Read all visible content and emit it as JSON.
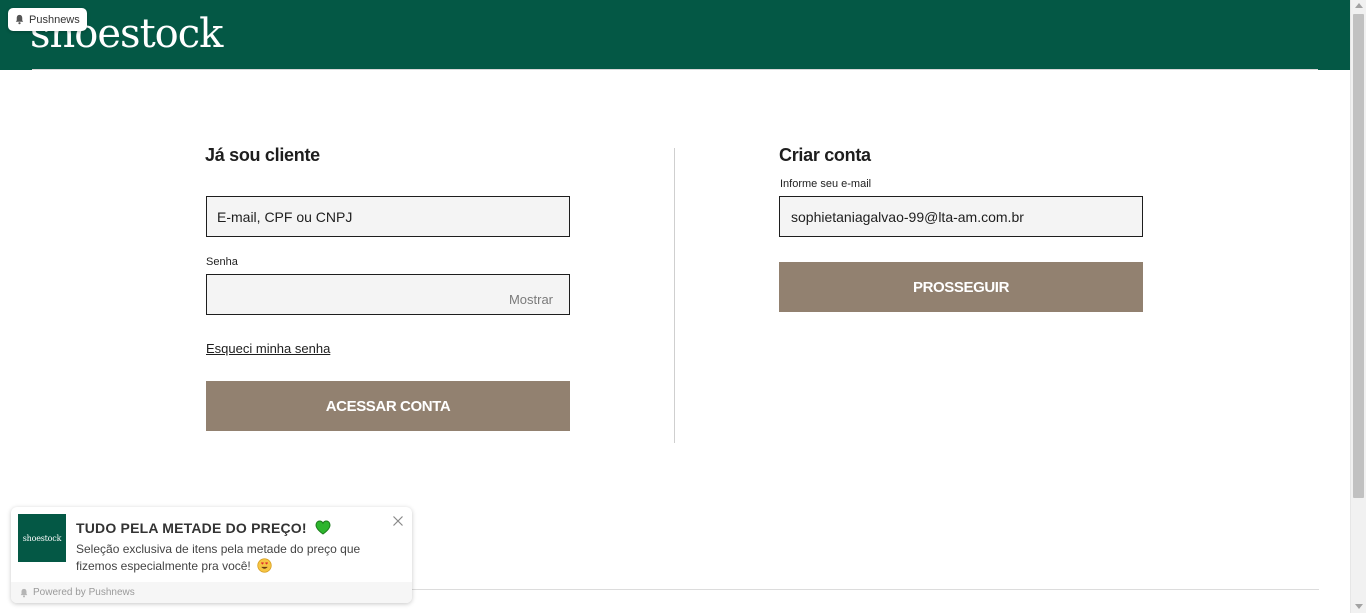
{
  "header": {
    "logo": "shoestock"
  },
  "pushnews_badge": {
    "label": "Pushnews",
    "icon": "bell-icon"
  },
  "login": {
    "title": "Já sou cliente",
    "email_placeholder": "E-mail, CPF ou CNPJ",
    "password_label": "Senha",
    "password_value": "",
    "show_label": "Mostrar",
    "forgot_label": "Esqueci minha senha",
    "submit_label": "ACESSAR CONTA"
  },
  "register": {
    "title": "Criar conta",
    "email_label": "Informe seu e-mail",
    "email_value": "sophietaniagalvao-99@lta-am.com.br",
    "submit_label": "PROSSEGUIR"
  },
  "notification": {
    "thumb_text": "shoestock",
    "title": "TUDO PELA METADE DO PREÇO!",
    "title_icon": "green-heart-icon",
    "body": "Seleção exclusiva de itens pela metade do preço que fizemos especialmente pra você!",
    "body_icon": "heart-eyes-face-icon",
    "footer": "Powered by Pushnews"
  },
  "colors": {
    "header_bg": "#045845",
    "button_bg": "#928170",
    "input_bg": "#f4f4f4"
  }
}
